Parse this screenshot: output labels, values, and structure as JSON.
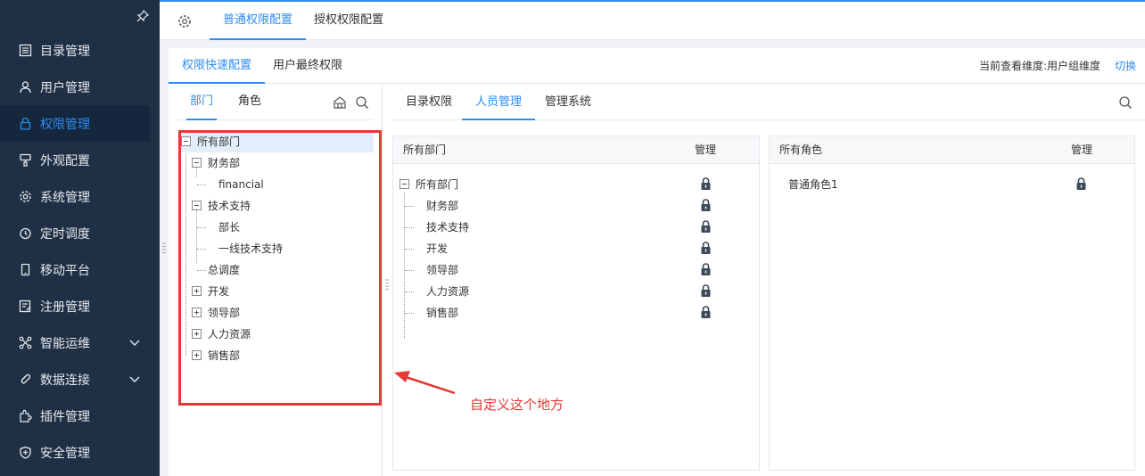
{
  "sidebar": {
    "items": [
      {
        "label": "目录管理",
        "icon": "catalog-icon"
      },
      {
        "label": "用户管理",
        "icon": "user-icon"
      },
      {
        "label": "权限管理",
        "icon": "lock-icon"
      },
      {
        "label": "外观配置",
        "icon": "appearance-icon"
      },
      {
        "label": "系统管理",
        "icon": "gear-icon"
      },
      {
        "label": "定时调度",
        "icon": "clock-icon"
      },
      {
        "label": "移动平台",
        "icon": "mobile-icon"
      },
      {
        "label": "注册管理",
        "icon": "register-icon"
      },
      {
        "label": "智能运维",
        "icon": "ops-icon"
      },
      {
        "label": "数据连接",
        "icon": "link-icon"
      },
      {
        "label": "插件管理",
        "icon": "plugin-icon"
      },
      {
        "label": "安全管理",
        "icon": "shield-icon"
      }
    ]
  },
  "top_tabs": [
    "普通权限配置",
    "授权权限配置"
  ],
  "sub_tabs": [
    "权限快速配置",
    "用户最终权限"
  ],
  "dimension_text": "当前查看维度:用户组维度",
  "switch_label": "切换",
  "left_tabs": [
    "部门",
    "角色"
  ],
  "tree": {
    "root": "所有部门",
    "finance": "财务部",
    "financial": "financial",
    "tech": "技术支持",
    "dept_head": "部长",
    "frontline": "一线技术支持",
    "dispatch": "总调度",
    "dev": "开发",
    "leaders": "领导部",
    "hr": "人力资源",
    "sales": "销售部"
  },
  "right_tabs": [
    "目录权限",
    "人员管理",
    "管理系统"
  ],
  "dept_card": {
    "header": "所有部门",
    "manage": "管理",
    "root": "所有部门",
    "children": [
      "财务部",
      "技术支持",
      "开发",
      "领导部",
      "人力资源",
      "销售部"
    ]
  },
  "role_card": {
    "header": "所有角色",
    "manage": "管理",
    "roles": [
      "普通角色1"
    ]
  },
  "annotation": "自定义这个地方",
  "colors": {
    "accent": "#2d8cf0",
    "sidebar": "#1f3044",
    "annotation": "#e53935"
  }
}
